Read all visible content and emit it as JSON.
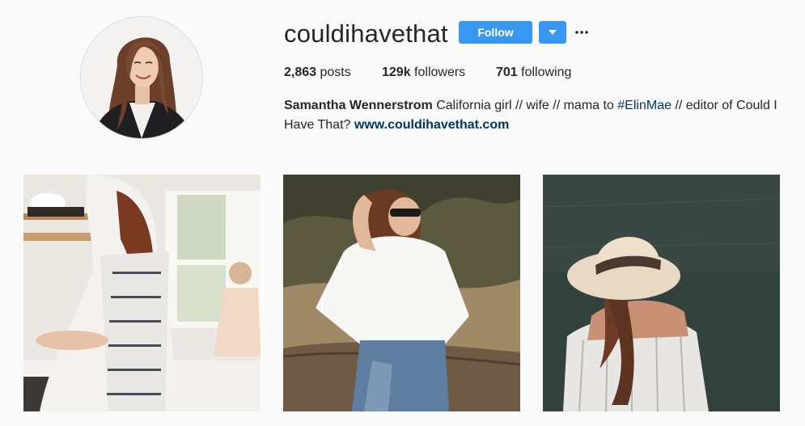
{
  "profile": {
    "username": "couldihavethat",
    "avatar_icon": "profile-photo",
    "follow_label": "Follow",
    "dropdown_icon": "chevron-down-icon",
    "more_icon": "ellipsis-icon",
    "accent_color": "#3897f0"
  },
  "stats": {
    "posts_count": "2,863",
    "posts_label": "posts",
    "followers_count": "129k",
    "followers_label": "followers",
    "following_count": "701",
    "following_label": "following"
  },
  "bio": {
    "full_name": "Samantha Wennerstrom",
    "text_1": "California girl // wife // mama to",
    "hashtag": "#ElinMae",
    "text_2": "// editor of Could I Have That?",
    "url": "www.couldihavethat.com",
    "link_color": "#003569"
  },
  "posts": [
    {
      "alt": "kitchen-photo"
    },
    {
      "alt": "outdoor-portrait-photo"
    },
    {
      "alt": "hat-by-water-photo"
    }
  ]
}
